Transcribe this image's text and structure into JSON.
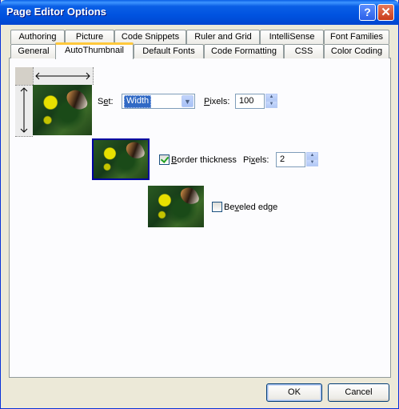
{
  "window": {
    "title": "Page Editor Options",
    "help_label": "?",
    "close_label": "✕"
  },
  "tabs_back": [
    "Authoring",
    "Picture",
    "Code Snippets",
    "Ruler and Grid",
    "IntelliSense",
    "Font Families"
  ],
  "tabs_front": [
    "General",
    "AutoThumbnail",
    "Default Fonts",
    "Code Formatting",
    "CSS",
    "Color Coding"
  ],
  "active_tab": "AutoThumbnail",
  "set": {
    "label_pre": "S",
    "label_u": "e",
    "label_post": "t:",
    "value": "Width"
  },
  "pixels1": {
    "label_u": "P",
    "label_post": "ixels:",
    "value": "100"
  },
  "border": {
    "checked": true,
    "label_u": "B",
    "label_post": "order thickness"
  },
  "pixels2": {
    "label_pre": "Pi",
    "label_u": "x",
    "label_post": "els:",
    "value": "2"
  },
  "beveled": {
    "checked": false,
    "label_pre": "Be",
    "label_u": "v",
    "label_post": "eled edge"
  },
  "buttons": {
    "ok": "OK",
    "cancel": "Cancel"
  }
}
